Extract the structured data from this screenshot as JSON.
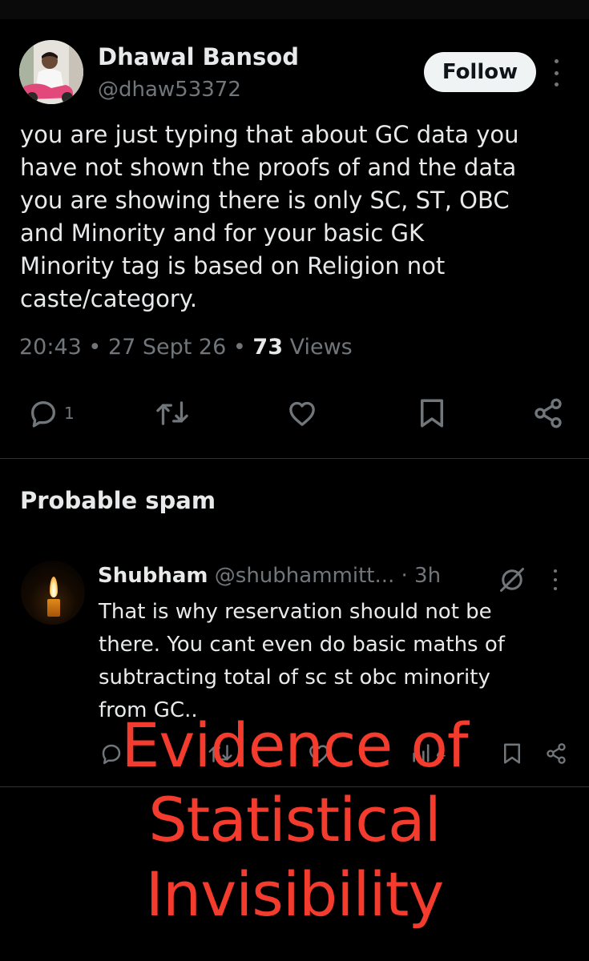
{
  "tweet": {
    "author_name": "Dhawal Bansod",
    "author_handle": "@dhaw53372",
    "follow_label": "Follow",
    "text": "you are just typing that about GC data you\nhave not shown the proofs of and the data\nyou are showing there is only SC, ST, OBC\nand Minority and for your basic GK\nMinority tag is based on Religion not\ncaste/category.",
    "time": "20:43",
    "date": "27 Sept 26",
    "views_count": "73",
    "views_label": "Views",
    "sep": "•",
    "reply_count": "1"
  },
  "section": {
    "title": "Probable spam"
  },
  "reply": {
    "name": "Shubham",
    "handle": "@shubhammitt...",
    "time": "· 3h",
    "text": "That is why reservation should not be\nthere. You cant even do basic maths of\nsubtracting total of sc st obc minority\nfrom GC..",
    "views_count": "4"
  },
  "overlay": {
    "text": "Evidence of\nStatistical\nInvisibility"
  },
  "colors": {
    "background": "#000000",
    "text_primary": "#e7e9ea",
    "text_secondary": "#71767b",
    "overlay_red": "#f33b2e",
    "follow_bg": "#eff3f4"
  },
  "icons": [
    "reply-icon",
    "retweet-icon",
    "like-icon",
    "bookmark-icon",
    "share-icon",
    "views-icon",
    "grok-icon",
    "more-icon"
  ]
}
